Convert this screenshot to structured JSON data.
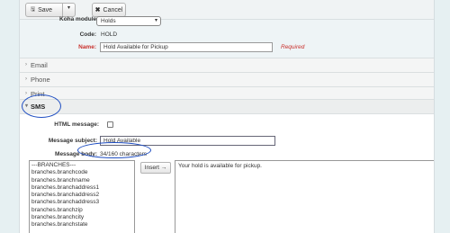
{
  "toolbar": {
    "save_label": "Save",
    "cancel_label": "Cancel",
    "save_icon": "save-icon",
    "cancel_icon": "close-icon"
  },
  "form": {
    "module_label": "Koha module:",
    "module_value": "Holds",
    "code_label": "Code:",
    "code_value": "HOLD",
    "name_label": "Name:",
    "name_value": "Hold Available for Pickup",
    "required_text": "Required"
  },
  "sections": {
    "email": "Email",
    "phone": "Phone",
    "print": "Print",
    "sms": "SMS"
  },
  "sms": {
    "html_message_label": "HTML message:",
    "html_message_checked": false,
    "subject_label": "Message subject:",
    "subject_value": "Hold Available",
    "body_label": "Message body:",
    "char_count": "34/160 characters",
    "insert_label": "Insert →",
    "body_value": "Your hold is available for pickup.",
    "fields": [
      "---BRANCHES---",
      "branches.branchcode",
      "branches.branchname",
      "branches.branchaddress1",
      "branches.branchaddress2",
      "branches.branchaddress3",
      "branches.branchzip",
      "branches.branchcity",
      "branches.branchstate"
    ]
  },
  "colors": {
    "accent_annotation": "#1f4ec2",
    "required": "#c9302c",
    "background": "#e6f0f2"
  }
}
